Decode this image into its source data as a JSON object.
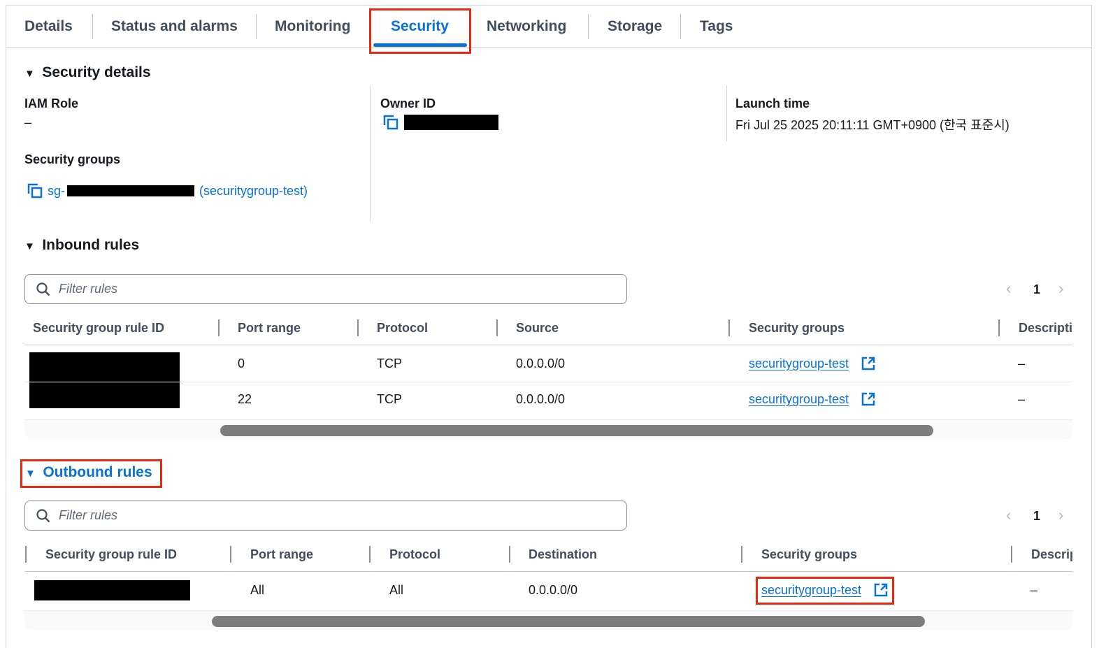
{
  "tabs": [
    "Details",
    "Status and alarms",
    "Monitoring",
    "Security",
    "Networking",
    "Storage",
    "Tags"
  ],
  "active_tab": "Security",
  "accent": "#0972d3",
  "highlight": "#e8280f",
  "security_details": {
    "title": "Security details",
    "iam_role_label": "IAM Role",
    "iam_role_value": "–",
    "owner_id_label": "Owner ID",
    "launch_time_label": "Launch time",
    "launch_time_value": "Fri Jul 25 2025 20:11:11 GMT+0900 (한국 표준시)",
    "security_groups_label": "Security groups",
    "sg_prefix": "sg-",
    "sg_name": "(securitygroup-test)"
  },
  "inbound": {
    "title": "Inbound rules",
    "filter_placeholder": "Filter rules",
    "page": "1",
    "columns": [
      "Security group rule ID",
      "Port range",
      "Protocol",
      "Source",
      "Security groups",
      "Descripti"
    ],
    "rows": [
      {
        "port": "0",
        "protocol": "TCP",
        "source": "0.0.0.0/0",
        "sg": "securitygroup-test",
        "desc": "–"
      },
      {
        "port": "22",
        "protocol": "TCP",
        "source": "0.0.0.0/0",
        "sg": "securitygroup-test",
        "desc": "–"
      }
    ]
  },
  "outbound": {
    "title": "Outbound rules",
    "filter_placeholder": "Filter rules",
    "page": "1",
    "columns": [
      "Security group rule ID",
      "Port range",
      "Protocol",
      "Destination",
      "Security groups",
      "Descrip"
    ],
    "rows": [
      {
        "port": "All",
        "protocol": "All",
        "destination": "0.0.0.0/0",
        "sg": "securitygroup-test",
        "desc": "–"
      }
    ]
  }
}
